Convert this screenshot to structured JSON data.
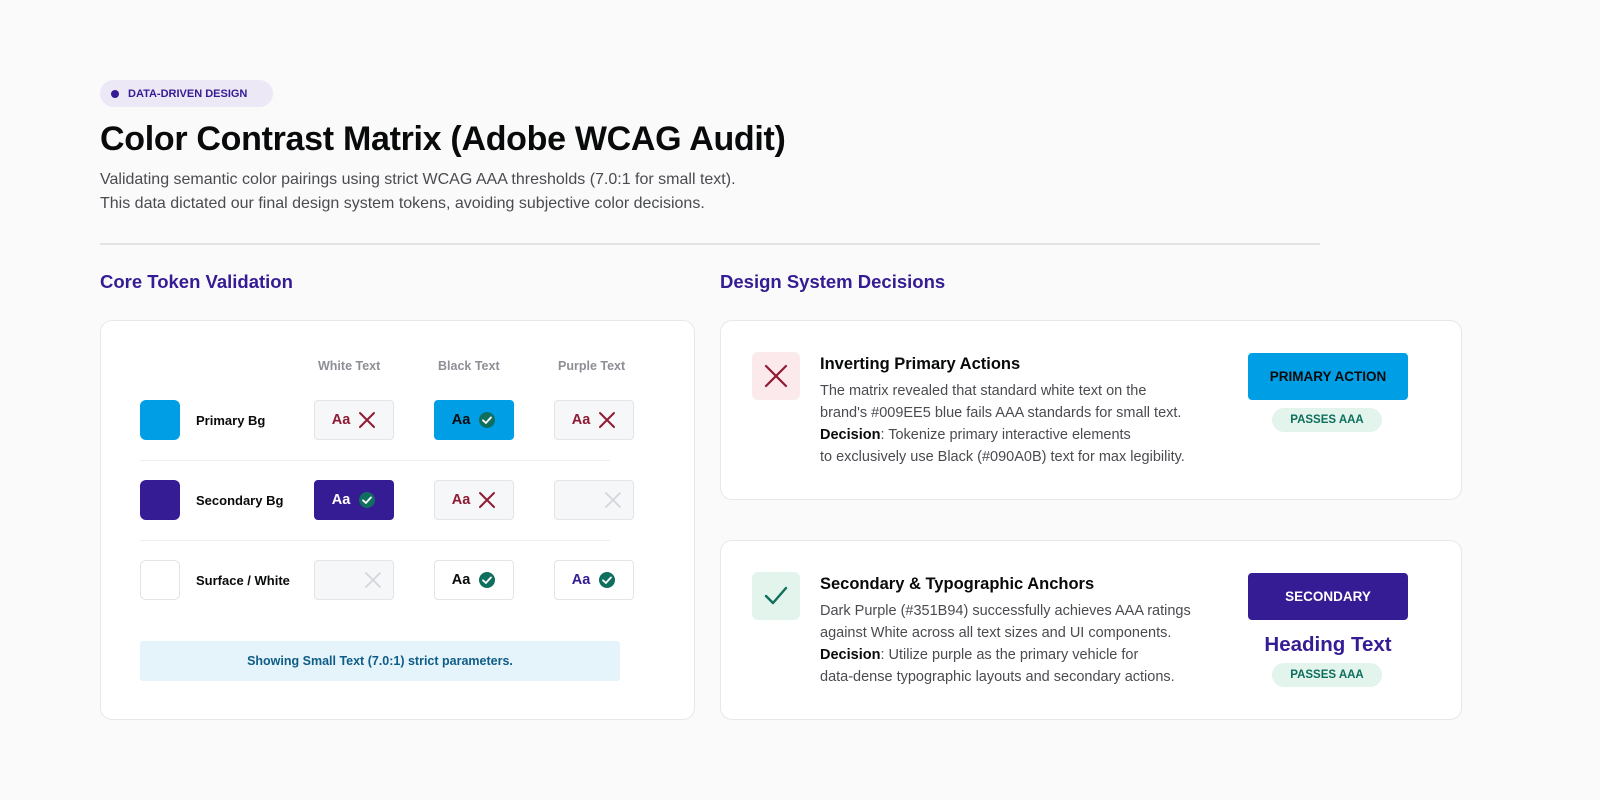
{
  "header": {
    "tag": "DATA-DRIVEN DESIGN",
    "title": "Color Contrast Matrix (Adobe WCAG Audit)",
    "subtitle_line1": "Validating semantic color pairings using strict WCAG AAA thresholds (7.0:1 for small text).",
    "subtitle_line2": "This data dictated our final design system tokens, avoiding subjective color decisions."
  },
  "matrix": {
    "title": "Core Token Validation",
    "columns": [
      "White Text",
      "Black Text",
      "Purple Text"
    ],
    "rows": [
      {
        "label": "Primary Bg",
        "swatch": "#009EE5",
        "cells": [
          {
            "sample": "Aa",
            "result": "fail",
            "bg": "#F6F7F9",
            "fg": "#8E1B33"
          },
          {
            "sample": "Aa",
            "result": "pass",
            "bg": "#009EE5",
            "fg": "#090A0B"
          },
          {
            "sample": "Aa",
            "result": "fail",
            "bg": "#F6F7F9",
            "fg": "#8E1B33"
          }
        ]
      },
      {
        "label": "Secondary Bg",
        "swatch": "#351B94",
        "cells": [
          {
            "sample": "Aa",
            "result": "pass",
            "bg": "#351B94",
            "fg": "#FFFFFF"
          },
          {
            "sample": "Aa",
            "result": "fail",
            "bg": "#F6F7F9",
            "fg": "#8E1B33"
          },
          {
            "sample": "",
            "result": "na",
            "bg": "#F6F7F9",
            "fg": "#D4D5DA"
          }
        ]
      },
      {
        "label": "Surface / White",
        "swatch": "#FFFFFF",
        "cells": [
          {
            "sample": "",
            "result": "na",
            "bg": "#F6F7F9",
            "fg": "#D4D5DA"
          },
          {
            "sample": "Aa",
            "result": "pass",
            "bg": "#FFFFFF",
            "fg": "#090A0B"
          },
          {
            "sample": "Aa",
            "result": "pass",
            "bg": "#FFFFFF",
            "fg": "#351B94"
          }
        ]
      }
    ],
    "note": "Showing Small Text (7.0:1) strict parameters."
  },
  "decisions": {
    "title": "Design System Decisions",
    "items": [
      {
        "icon": "close-icon",
        "title": "Inverting Primary Actions",
        "line1": "The matrix revealed that standard white text on the",
        "line2": "brand's #009EE5 blue fails AAA standards for small text.",
        "decision_label": "Decision",
        "line3": ": Tokenize primary interactive elements",
        "line4": "to exclusively use Black (#090A0B) text for max legibility.",
        "button_label": "PRIMARY ACTION",
        "badge": "PASSES AAA"
      },
      {
        "icon": "check-icon",
        "title": "Secondary & Typographic Anchors",
        "line1": "Dark Purple (#351B94) successfully achieves AAA ratings",
        "line2": "against White across all text sizes and UI components.",
        "decision_label": "Decision",
        "line3": ": Utilize purple as the primary vehicle for",
        "line4": "data-dense typographic layouts and secondary actions.",
        "button_label": "SECONDARY",
        "heading_sample": "Heading Text",
        "badge": "PASSES AAA"
      }
    ]
  },
  "colors": {
    "primary": "#009EE5",
    "secondary": "#351B94",
    "black": "#090A0B",
    "fail": "#8E1B33",
    "pass": "#0F6E5D"
  }
}
